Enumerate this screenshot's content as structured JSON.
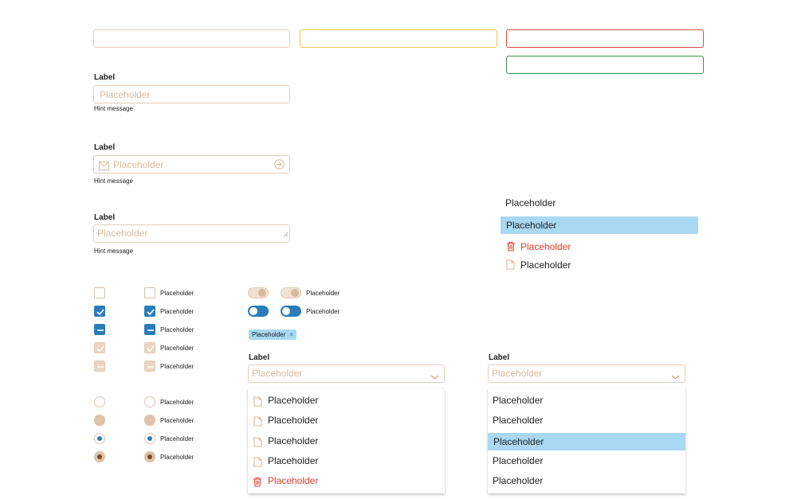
{
  "inputs_top": {
    "default": "",
    "warning": "",
    "error": "",
    "success": ""
  },
  "field1": {
    "label": "Label",
    "placeholder": "Placeholder",
    "hint": "Hint message"
  },
  "field2": {
    "label": "Label",
    "placeholder": "Placeholder",
    "hint": "Hint message",
    "leading_icon": "mail-icon",
    "trailing_icon": "arrow-right-circle-icon"
  },
  "field3": {
    "label": "Label",
    "placeholder": "Placeholder",
    "hint": "Hint message"
  },
  "standalone_list": {
    "items": [
      {
        "label": "Placeholder",
        "state": "default"
      },
      {
        "label": "Placeholder",
        "state": "selected"
      },
      {
        "label": "Placeholder",
        "state": "danger",
        "icon": "trash-icon"
      },
      {
        "label": "Placeholder",
        "state": "default",
        "icon": "file-icon"
      }
    ]
  },
  "checkboxes": {
    "labels": [
      "Placeholder",
      "Placeholder",
      "Placeholder",
      "Placeholder",
      "Placeholder"
    ]
  },
  "radios": {
    "labels": [
      "Placeholder",
      "Placeholder",
      "Placeholder",
      "Placeholder"
    ]
  },
  "toggles": {
    "labels": [
      "Placeholder",
      "Placeholder"
    ]
  },
  "chip": {
    "label": "Placeholder",
    "close": "×"
  },
  "select1": {
    "label": "Label",
    "placeholder": "Placeholder",
    "options": [
      {
        "label": "Placeholder",
        "icon": "file-icon"
      },
      {
        "label": "Placeholder",
        "icon": "file-icon"
      },
      {
        "label": "Placeholder",
        "icon": "file-icon"
      },
      {
        "label": "Placeholder",
        "icon": "file-icon"
      },
      {
        "label": "Placeholder",
        "icon": "trash-icon",
        "danger": true
      }
    ]
  },
  "select2": {
    "label": "Label",
    "placeholder": "Placeholder",
    "options": [
      {
        "label": "Placeholder"
      },
      {
        "label": "Placeholder"
      },
      {
        "label": "Placeholder",
        "selected": true
      },
      {
        "label": "Placeholder"
      },
      {
        "label": "Placeholder"
      }
    ]
  },
  "colors": {
    "default_border": "#e3cdb6",
    "warning_border": "#f2c45a",
    "error_border": "#e0473c",
    "success_border": "#3f8f4f",
    "accent": "#2a7db9",
    "highlight": "#a9d8f2",
    "danger": "#e03c31",
    "placeholder": "#d9b99a"
  }
}
